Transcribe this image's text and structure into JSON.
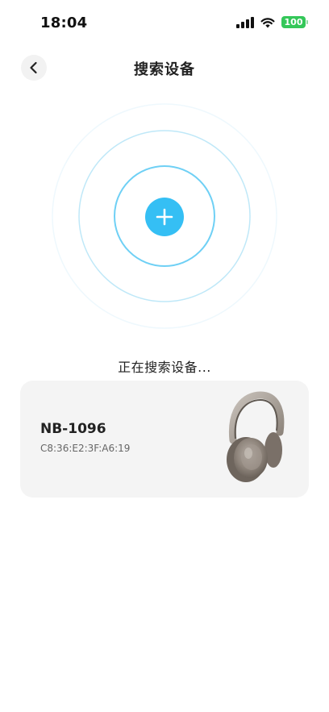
{
  "status_bar": {
    "time": "18:04",
    "battery_level": "100",
    "battery_color": "#34c759",
    "icons": [
      "signal-icon",
      "wifi-icon",
      "battery-icon"
    ]
  },
  "header": {
    "title": "搜索设备",
    "back_icon": "chevron-left-icon"
  },
  "radar": {
    "accent_color": "#35bff4",
    "center_icon": "plus-icon"
  },
  "search_status": {
    "text": "正在搜索设备..."
  },
  "devices": [
    {
      "name": "NB-1096",
      "mac": "C8:36:E2:3F:A6:19",
      "image": "headphones-image"
    }
  ]
}
